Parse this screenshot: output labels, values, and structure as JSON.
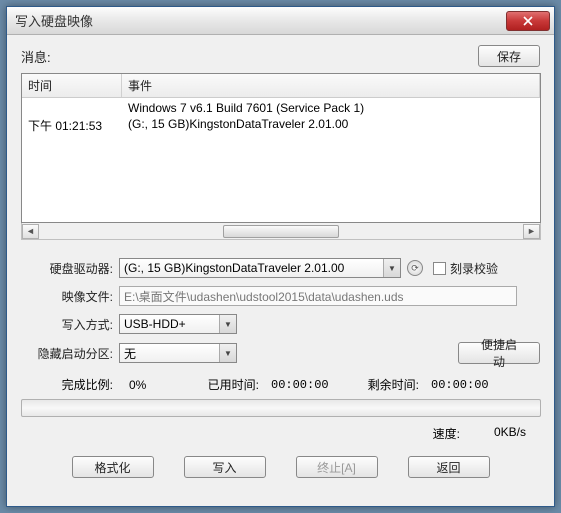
{
  "title": "写入硬盘映像",
  "msg_label": "消息:",
  "save_btn": "保存",
  "log": {
    "col_time": "时间",
    "col_event": "事件",
    "rows": [
      {
        "time": "",
        "event": "Windows 7 v6.1 Build 7601 (Service Pack 1)"
      },
      {
        "time": "下午 01:21:53",
        "event": "(G:, 15 GB)KingstonDataTraveler 2.01.00"
      }
    ]
  },
  "form": {
    "drive_label": "硬盘驱动器:",
    "drive_value": "(G:, 15 GB)KingstonDataTraveler 2.01.00",
    "verify_label": "刻录校验",
    "image_label": "映像文件:",
    "image_value": "E:\\桌面文件\\udashen\\udstool2015\\data\\udashen.uds",
    "mode_label": "写入方式:",
    "mode_value": "USB-HDD+",
    "hide_label": "隐藏启动分区:",
    "hide_value": "无",
    "quick_btn": "便捷启动"
  },
  "stats": {
    "pct_label": "完成比例:",
    "pct_value": "0%",
    "elapsed_label": "已用时间:",
    "elapsed_value": "00:00:00",
    "remain_label": "剩余时间:",
    "remain_value": "00:00:00",
    "speed_label": "速度:",
    "speed_value": "0KB/s"
  },
  "buttons": {
    "format": "格式化",
    "write": "写入",
    "abort": "终止[A]",
    "back": "返回"
  }
}
